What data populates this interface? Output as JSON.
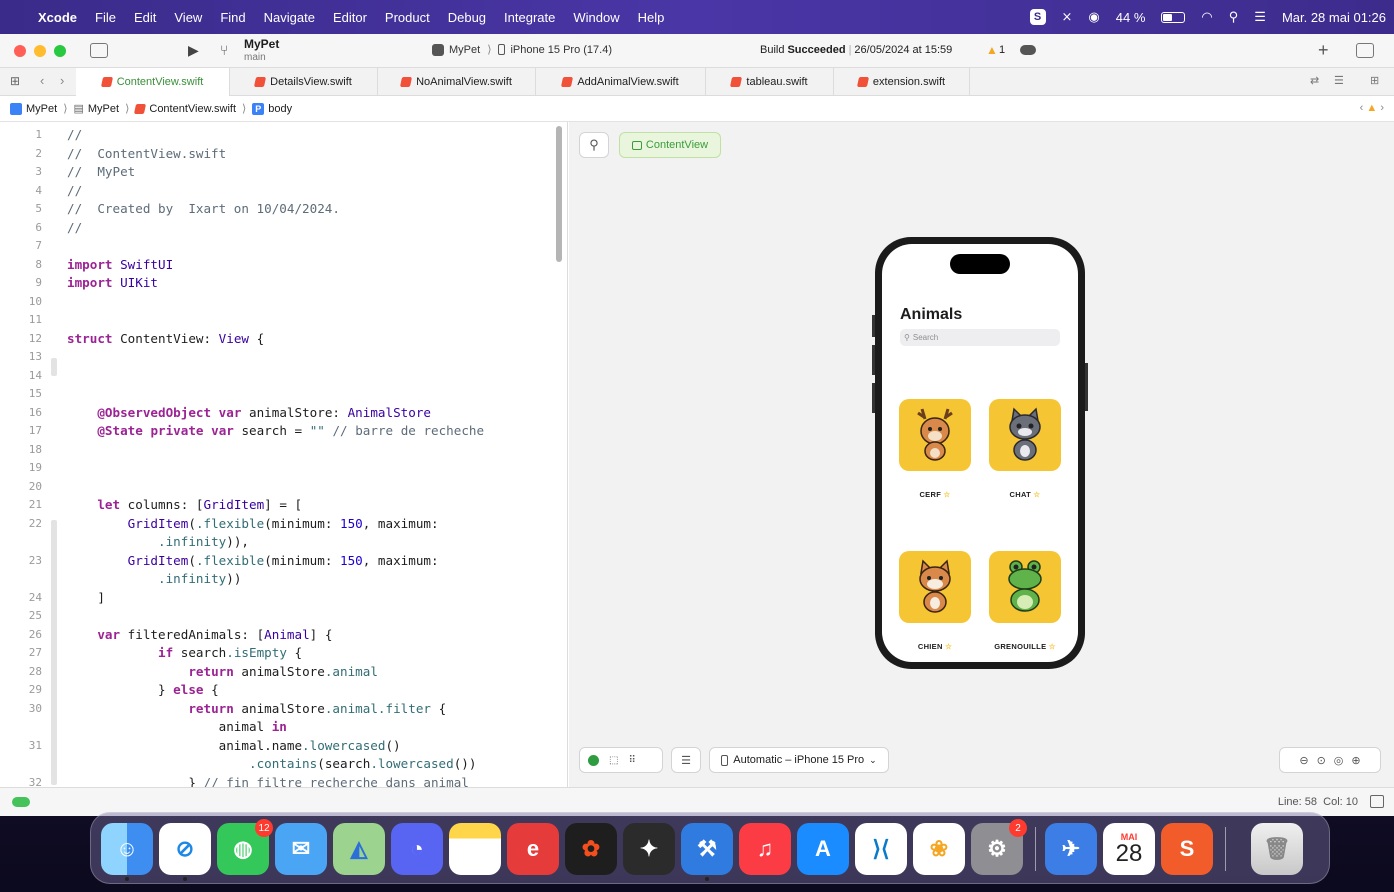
{
  "menubar": {
    "app": "Xcode",
    "items": [
      "File",
      "Edit",
      "View",
      "Find",
      "Navigate",
      "Editor",
      "Product",
      "Debug",
      "Integrate",
      "Window",
      "Help"
    ],
    "battery": "44 %",
    "datetime": "Mar. 28 mai 01:26"
  },
  "toolbar": {
    "scheme": "MyPet",
    "branch": "main",
    "target": "MyPet",
    "device": "iPhone 15 Pro (17.4)",
    "build_status_prefix": "Build",
    "build_status": "Succeeded",
    "build_date": "26/05/2024 at 15:59",
    "warnings": "1"
  },
  "tabs": [
    "ContentView.swift",
    "DetailsView.swift",
    "NoAnimalView.swift",
    "AddAnimalView.swift",
    "tableau.swift",
    "extension.swift"
  ],
  "breadcrumb": [
    "MyPet",
    "MyPet",
    "ContentView.swift",
    "body"
  ],
  "code_lines": [
    {
      "n": "1",
      "t": "//"
    },
    {
      "n": "2",
      "t": "//  ContentView.swift"
    },
    {
      "n": "3",
      "t": "//  MyPet"
    },
    {
      "n": "4",
      "t": "//"
    },
    {
      "n": "5",
      "t": "//  Created by  Ixart on 10/04/2024."
    },
    {
      "n": "6",
      "t": "//"
    },
    {
      "n": "7",
      "t": ""
    },
    {
      "n": "8",
      "t": "import SwiftUI"
    },
    {
      "n": "9",
      "t": "import UIKit"
    },
    {
      "n": "10",
      "t": ""
    },
    {
      "n": "11",
      "t": ""
    },
    {
      "n": "12",
      "t": "struct ContentView: View {"
    },
    {
      "n": "13",
      "t": ""
    },
    {
      "n": "14",
      "t": ""
    },
    {
      "n": "15",
      "t": ""
    },
    {
      "n": "16",
      "t": "    @ObservedObject var animalStore: AnimalStore"
    },
    {
      "n": "17",
      "t": "    @State private var search = \"\" // barre de recheche"
    },
    {
      "n": "18",
      "t": ""
    },
    {
      "n": "19",
      "t": ""
    },
    {
      "n": "20",
      "t": ""
    },
    {
      "n": "21",
      "t": "    let columns: [GridItem] = ["
    },
    {
      "n": "22",
      "t": "        GridItem(.flexible(minimum: 150, maximum:"
    },
    {
      "n": "",
      "t": "            .infinity)),"
    },
    {
      "n": "23",
      "t": "        GridItem(.flexible(minimum: 150, maximum:"
    },
    {
      "n": "",
      "t": "            .infinity))"
    },
    {
      "n": "24",
      "t": "    ]"
    },
    {
      "n": "25",
      "t": ""
    },
    {
      "n": "26",
      "t": "    var filteredAnimals: [Animal] {"
    },
    {
      "n": "27",
      "t": "            if search.isEmpty {"
    },
    {
      "n": "28",
      "t": "                return animalStore.animal"
    },
    {
      "n": "29",
      "t": "            } else {"
    },
    {
      "n": "30",
      "t": "                return animalStore.animal.filter {"
    },
    {
      "n": "",
      "t": "                    animal in"
    },
    {
      "n": "31",
      "t": "                    animal.name.lowercased()"
    },
    {
      "n": "",
      "t": "                        .contains(search.lowercased())"
    },
    {
      "n": "32",
      "t": "                } // fin filtre recherche dans animal"
    }
  ],
  "canvas": {
    "pin_label": "",
    "preview_label": "ContentView",
    "device_selector": "Automatic – iPhone 15 Pro"
  },
  "phone": {
    "title": "Animals",
    "search_placeholder": "Search",
    "animals": [
      "CERF",
      "CHAT",
      "CHIEN",
      "GRENOUILLE"
    ]
  },
  "status": {
    "position": "Line: 58  Col: 10"
  },
  "dock": {
    "messages_badge": "12",
    "settings_badge": "2",
    "calendar_month": "MAI",
    "calendar_day": "28"
  }
}
